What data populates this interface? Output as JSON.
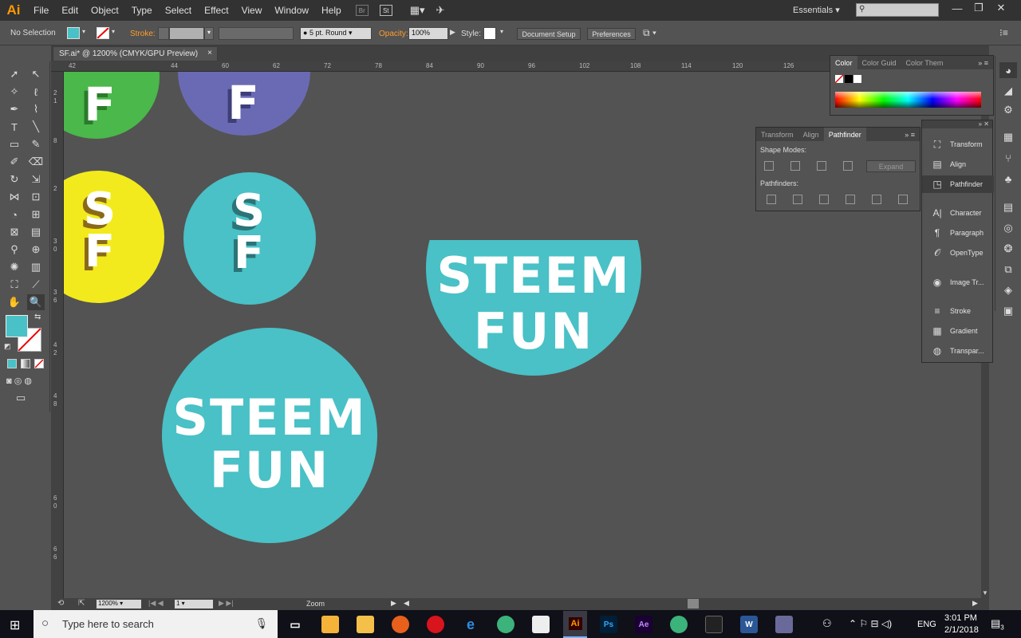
{
  "app": {
    "logo": "Ai",
    "menu": [
      "File",
      "Edit",
      "Object",
      "Type",
      "Select",
      "Effect",
      "View",
      "Window",
      "Help"
    ],
    "menu_chips": [
      "Br",
      "St"
    ],
    "workspace": "Essentials",
    "window_buttons": [
      "—",
      "❐",
      "✕"
    ]
  },
  "control_bar": {
    "selection": "No Selection",
    "stroke_label": "Stroke:",
    "brush": "5 pt. Round",
    "opacity_label": "Opacity:",
    "opacity_value": "100%",
    "style_label": "Style:",
    "document_setup": "Document Setup",
    "preferences": "Preferences"
  },
  "document": {
    "tab_title": "SF.ai* @ 1200% (CMYK/GPU Preview)",
    "close": "×",
    "ruler_top": [
      "42",
      "44",
      "60",
      "62",
      "72",
      "78",
      "84",
      "90",
      "96",
      "102",
      "108",
      "114",
      "120",
      "126"
    ],
    "ruler_left": [
      "2",
      "1",
      "8",
      "2",
      "3",
      "0",
      "3",
      "6",
      "4",
      "2",
      "4",
      "8",
      "6",
      "0",
      "6",
      "6"
    ]
  },
  "artwork": {
    "green_letter": "F",
    "purple_letter": "F",
    "yellow_letters": "SF",
    "teal_letters": "SF",
    "wordmark_line1": "STEEM",
    "wordmark_line2": "FUN",
    "colors": {
      "green": "#4ab84a",
      "purple": "#6a6ab4",
      "yellow": "#f2ea1c",
      "teal": "#49c1c6",
      "canvas": "#535353"
    }
  },
  "color_panel": {
    "tabs": [
      "Color",
      "Color Guid",
      "Color Them"
    ]
  },
  "pathfinder_panel": {
    "tabs": [
      "Transform",
      "Align",
      "Pathfinder"
    ],
    "shape_modes": "Shape Modes:",
    "expand": "Expand",
    "pathfinders": "Pathfinders:"
  },
  "dock": {
    "items": [
      {
        "label": "Transform",
        "icon": "transform-icon"
      },
      {
        "label": "Align",
        "icon": "align-icon"
      },
      {
        "label": "Pathfinder",
        "icon": "pathfinder-icon"
      },
      {
        "label": "Character",
        "icon": "character-icon"
      },
      {
        "label": "Paragraph",
        "icon": "paragraph-icon"
      },
      {
        "label": "OpenType",
        "icon": "opentype-icon"
      },
      {
        "label": "Image Tr...",
        "icon": "image-trace-icon"
      },
      {
        "label": "Stroke",
        "icon": "stroke-icon"
      },
      {
        "label": "Gradient",
        "icon": "gradient-icon"
      },
      {
        "label": "Transpar...",
        "icon": "transparency-icon"
      }
    ]
  },
  "status_bar": {
    "zoom": "1200%",
    "artboard": "1",
    "tool": "Zoom"
  },
  "taskbar": {
    "search_placeholder": "Type here to search",
    "apps": [
      "Ai",
      "Ps",
      "Ae",
      "W"
    ],
    "language": "ENG",
    "time": "3:01 PM",
    "date": "2/1/2018",
    "notification_count": "3"
  }
}
